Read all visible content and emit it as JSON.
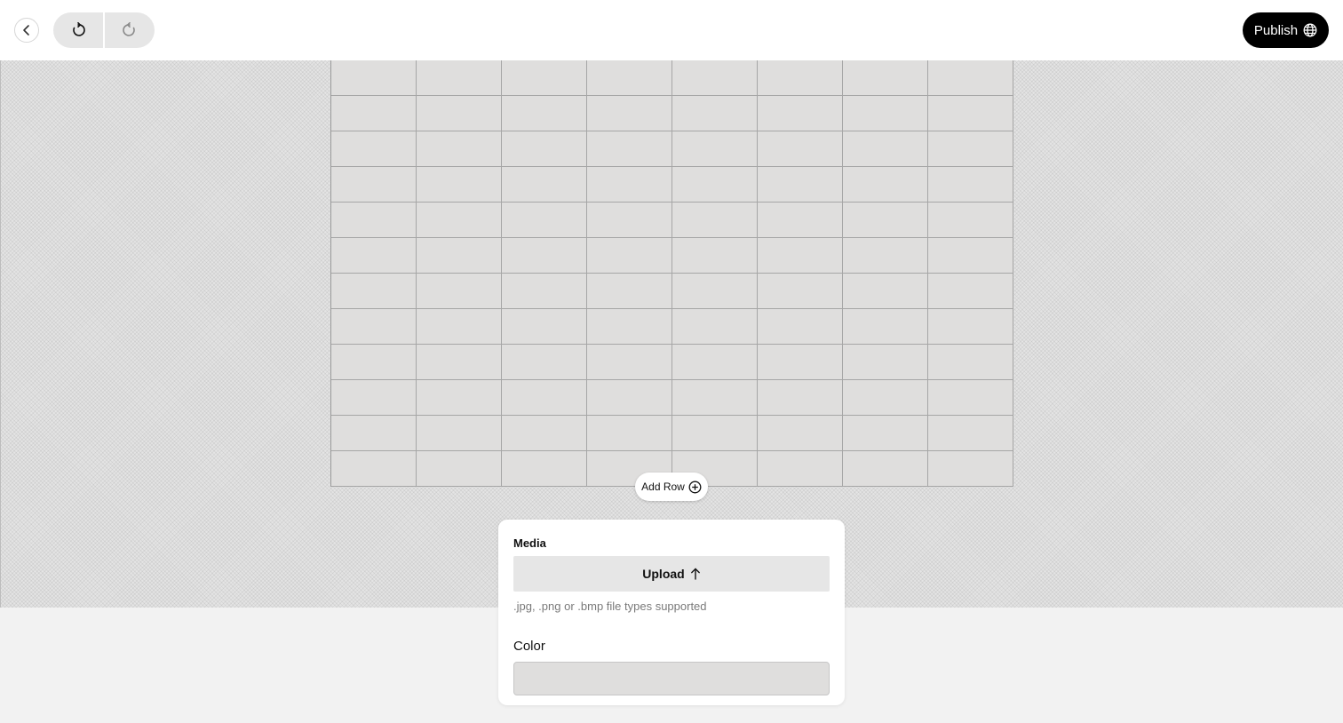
{
  "toolbar": {
    "back_icon": "chevron-left-icon",
    "undo_icon": "undo-icon",
    "redo_icon": "redo-icon",
    "publish_label": "Publish",
    "publish_icon": "globe-icon"
  },
  "grid": {
    "columns": 8,
    "rows": 12,
    "cell_color": "#dfdedd"
  },
  "add_row": {
    "label": "Add Row",
    "icon": "plus-circle-icon"
  },
  "media_panel": {
    "title": "Media",
    "upload_label": "Upload",
    "upload_icon": "arrow-up-icon",
    "help_text": ".jpg, .png or .bmp file types supported",
    "color_label": "Color",
    "color_value": "#dfdedd"
  },
  "colors": {
    "accent": "#000000",
    "toolbar_bg": "#ffffff",
    "page_bg": "#f2f2f2"
  }
}
